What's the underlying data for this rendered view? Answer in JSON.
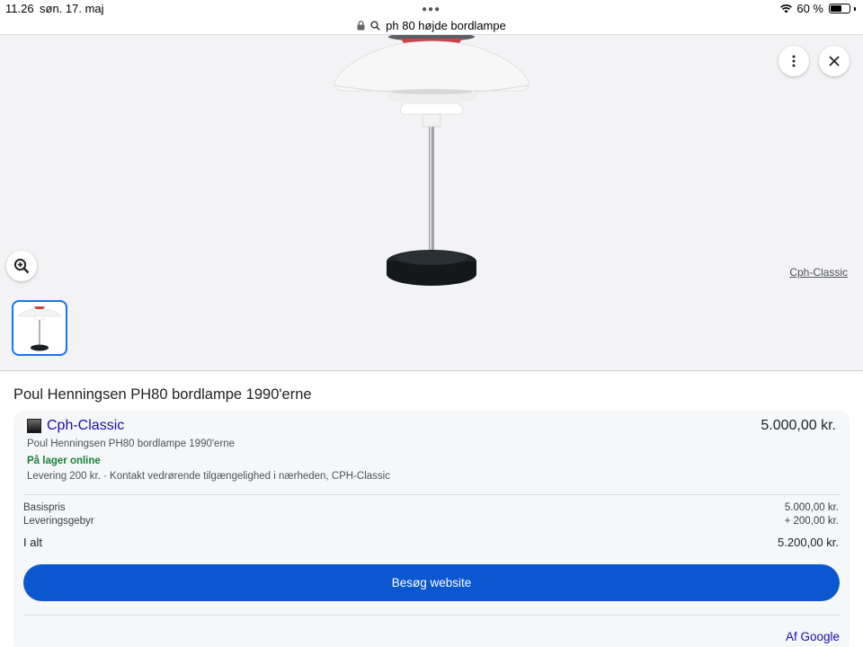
{
  "status_bar": {
    "time": "11.26",
    "date": "søn. 17. maj",
    "battery": "60 %",
    "battery_level": 0.6
  },
  "address_bar": {
    "query": "ph 80 højde bordlampe"
  },
  "viewer": {
    "source_label": "Cph-Classic",
    "icons": [
      "more-vert-icon",
      "close-icon",
      "zoom-in-icon"
    ]
  },
  "product": {
    "title": "Poul Henningsen PH80 bordlampe 1990'erne"
  },
  "offer": {
    "merchant": "Cph-Classic",
    "price": "5.000,00 kr.",
    "description": "Poul Henningsen PH80 bordlampe 1990'erne",
    "stock": "På lager online",
    "delivery": "Levering 200 kr. · Kontakt vedrørende tilgængelighed i nærheden, CPH-Classic",
    "base_label": "Basispris",
    "base_value": "5.000,00 kr.",
    "fee_label": "Leveringsgebyr",
    "fee_value": "+ 200,00 kr.",
    "total_label": "I alt",
    "total_value": "5.200,00 kr.",
    "visit_label": "Besøg website",
    "by_google": "Af Google"
  },
  "colors": {
    "link": "#1a0dab",
    "button": "#0b57d0",
    "stock_green": "#188038",
    "thumb_border": "#1a73e8"
  }
}
